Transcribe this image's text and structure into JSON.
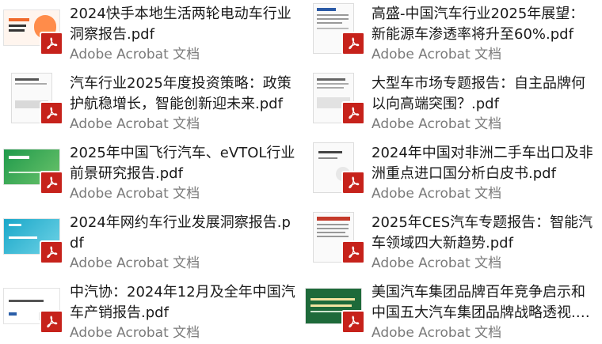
{
  "files": [
    {
      "title": "2024快手本地生活两轮电动车行业洞察报告.pdf",
      "type": "Adobe Acrobat 文档",
      "thumb": "orange-cover"
    },
    {
      "title": "高盛-中国汽车行业2025年展望：新能源车渗透率将升至60%.pdf",
      "type": "Adobe Acrobat 文档",
      "thumb": "document-page"
    },
    {
      "title": "汽车行业2025年度投资策略：政策护航稳增长，智能创新迎未来.pdf",
      "type": "Adobe Acrobat 文档",
      "thumb": "document-page"
    },
    {
      "title": "大型车市场专题报告：自主品牌何以向高端突围？.pdf",
      "type": "Adobe Acrobat 文档",
      "thumb": "document-page"
    },
    {
      "title": "2025年中国飞行汽车、eVTOL行业前景研究报告.pdf",
      "type": "Adobe Acrobat 文档",
      "thumb": "green-slide"
    },
    {
      "title": "2024年中国对非洲二手车出口及非洲重点进口国分析白皮书.pdf",
      "type": "Adobe Acrobat 文档",
      "thumb": "document-page"
    },
    {
      "title": "2024年网约车行业发展洞察报告.pdf",
      "type": "Adobe Acrobat 文档",
      "thumb": "teal-slide"
    },
    {
      "title": "2025年CES汽车专题报告：智能汽车领域四大新趋势.pdf",
      "type": "Adobe Acrobat 文档",
      "thumb": "red-document"
    },
    {
      "title": "中汽协：2024年12月及全年中国汽车产销报告.pdf",
      "type": "Adobe Acrobat 文档",
      "thumb": "white-slide"
    },
    {
      "title": "美国汽车集团品牌百年竞争启示和中国五大汽车集团品牌战略透视.pdf",
      "type": "Adobe Acrobat 文档",
      "thumb": "green-banner"
    }
  ],
  "icons": {
    "file_type": "pdf-icon"
  },
  "colors": {
    "pdf_badge": "#c6221b"
  }
}
